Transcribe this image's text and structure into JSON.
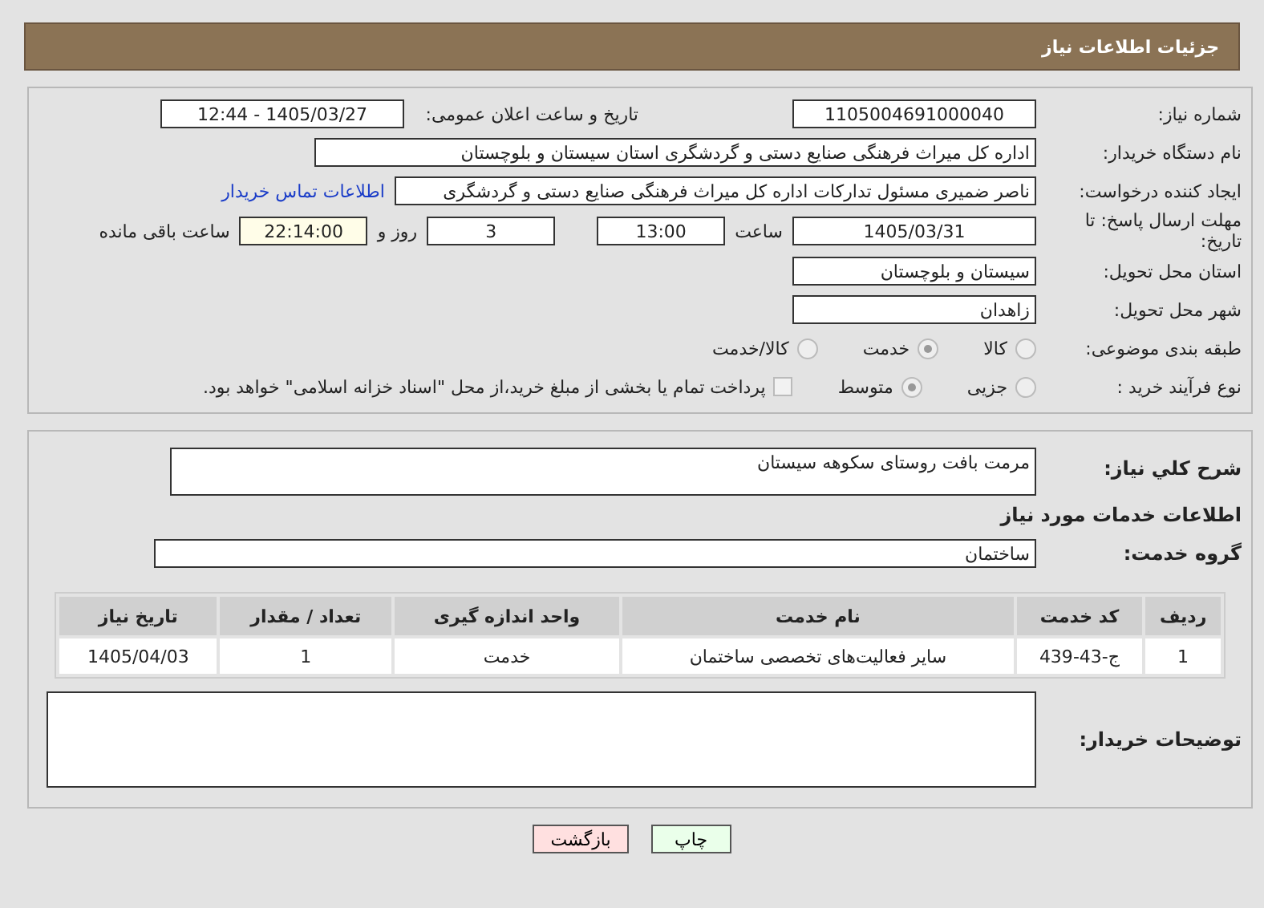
{
  "header": {
    "title": "جزئیات اطلاعات نیاز"
  },
  "need_number": {
    "label": "شماره نیاز:",
    "value": "1105004691000040"
  },
  "announce": {
    "label": "تاریخ و ساعت اعلان عمومی:",
    "value": "1405/03/27 - 12:44"
  },
  "buyer_org": {
    "label": "نام دستگاه خریدار:",
    "value": "اداره کل میراث فرهنگی  صنایع دستی و گردشگری استان سیستان و بلوچستان"
  },
  "creator": {
    "label": "ایجاد کننده درخواست:",
    "value": "ناصر ضمیری مسئول تدارکات اداره کل میراث فرهنگی  صنایع دستی و گردشگری",
    "link": "اطلاعات تماس خریدار"
  },
  "deadline": {
    "label": "مهلت ارسال پاسخ: تا تاریخ:",
    "date": "1405/03/31",
    "time_label": "ساعت",
    "time": "13:00",
    "days": "3",
    "days_label": "روز و",
    "remaining": "22:14:00",
    "remaining_label": "ساعت باقی مانده"
  },
  "province": {
    "label": "استان محل تحویل:",
    "value": "سیستان و بلوچستان"
  },
  "city": {
    "label": "شهر محل تحویل:",
    "value": "زاهدان"
  },
  "category": {
    "label": "طبقه بندی موضوعی:",
    "options": [
      {
        "label": "کالا",
        "selected": false
      },
      {
        "label": "خدمت",
        "selected": true
      },
      {
        "label": "کالا/خدمت",
        "selected": false
      }
    ]
  },
  "process": {
    "label": "نوع فرآیند خرید :",
    "options": [
      {
        "label": "جزیی",
        "selected": false
      },
      {
        "label": "متوسط",
        "selected": true
      }
    ],
    "payment": {
      "checked": false,
      "label": "پرداخت تمام یا بخشی از مبلغ خرید،از محل \"اسناد خزانه اسلامی\" خواهد بود."
    }
  },
  "description": {
    "label": "شرح کلي نياز:",
    "value": "مرمت بافت روستای سکوهه سیستان"
  },
  "services_title": "اطلاعات خدمات مورد نیاز",
  "service_group": {
    "label": "گروه خدمت:",
    "value": "ساختمان"
  },
  "table": {
    "columns": [
      "ردیف",
      "کد خدمت",
      "نام خدمت",
      "واحد اندازه گیری",
      "تعداد / مقدار",
      "تاریخ نیاز"
    ],
    "rows": [
      [
        "1",
        "ج-43-439",
        "سایر فعالیت‌های تخصصی ساختمان",
        "خدمت",
        "1",
        "1405/04/03"
      ]
    ]
  },
  "buyer_notes": {
    "label": "توضیحات خریدار:"
  },
  "buttons": [
    {
      "label": "چاپ",
      "kind": "print"
    },
    {
      "label": "بازگشت",
      "kind": "back"
    }
  ]
}
